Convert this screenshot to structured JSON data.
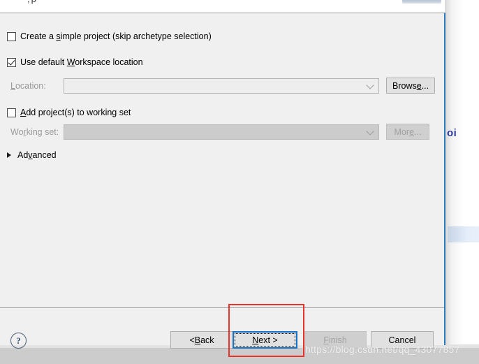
{
  "backdrop": {
    "code_fragment": "oi",
    "watermark": "https://blog.csdn.net/qq_43077857"
  },
  "dialog": {
    "options": {
      "simple_project": {
        "label_pre": "Create a ",
        "label_mnemonic": "s",
        "label_post": "imple project (skip archetype selection)",
        "checked": false
      },
      "default_workspace": {
        "label_pre": "Use default ",
        "label_mnemonic": "W",
        "label_post": "orkspace location",
        "checked": true
      },
      "working_set": {
        "label_pre": "",
        "label_mnemonic": "A",
        "label_post": "dd project(s) to working set",
        "checked": false
      }
    },
    "location": {
      "label_pre": "",
      "label_mnemonic": "L",
      "label_post": "ocation:",
      "value": "",
      "enabled": false,
      "browse_pre": "Brows",
      "browse_mnemonic": "e",
      "browse_post": "...",
      "browse_enabled": true
    },
    "working_set_field": {
      "label_pre": "Wo",
      "label_mnemonic": "r",
      "label_post": "king set:",
      "value": "",
      "enabled": false,
      "more_pre": "Mor",
      "more_mnemonic": "e",
      "more_post": "...",
      "more_enabled": false
    },
    "advanced": {
      "label_pre": "Ad",
      "label_mnemonic": "v",
      "label_post": "anced",
      "expanded": false,
      "arrow_icon": "triangle-right-icon"
    },
    "footer": {
      "help_glyph": "?",
      "buttons": [
        {
          "id": "back",
          "pre": "< ",
          "mnemonic": "B",
          "post": "ack",
          "state": "enabled",
          "default": false
        },
        {
          "id": "next",
          "pre": "",
          "mnemonic": "N",
          "post": "ext >",
          "state": "enabled",
          "default": true
        },
        {
          "id": "finish",
          "pre": "",
          "mnemonic": "F",
          "post": "inish",
          "state": "disabled",
          "default": false
        },
        {
          "id": "cancel",
          "pre": "Cancel",
          "mnemonic": "",
          "post": "",
          "state": "enabled",
          "default": false
        }
      ]
    }
  },
  "colors": {
    "dialog_bg": "#f0f0f0",
    "dialog_accent_border": "#2a7ab9",
    "default_button_border": "#1572c6",
    "annotation_red": "#e8332a",
    "code_blue": "#2b3a9e",
    "selected_row_blue": "#e4edfa"
  }
}
